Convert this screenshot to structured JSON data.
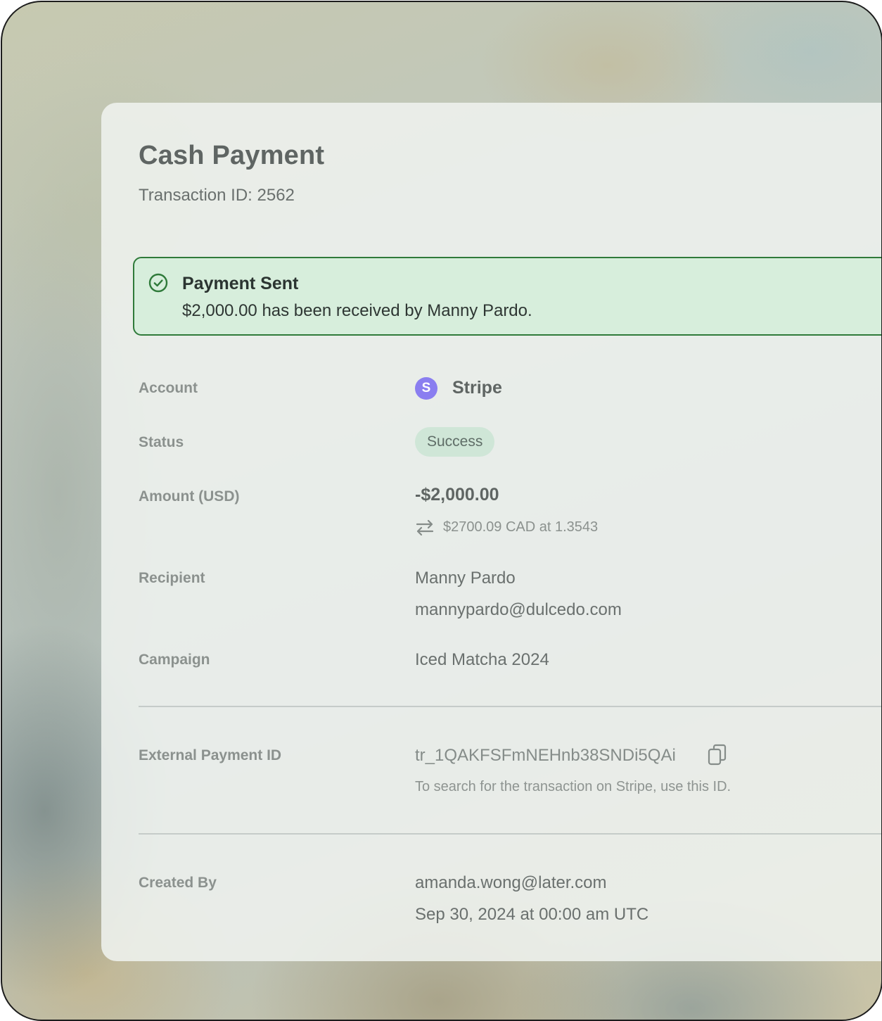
{
  "header": {
    "title": "Cash Payment",
    "transaction_id_label": "Transaction ID: 2562"
  },
  "alert": {
    "icon": "check-circle-icon",
    "title": "Payment Sent",
    "message": "$2,000.00 has been received by Manny Pardo.",
    "color": "#2f7a3a"
  },
  "details": {
    "account": {
      "label": "Account",
      "icon": "stripe-logo",
      "icon_letter": "S",
      "icon_color": "#8a7ef0",
      "value": "Stripe"
    },
    "status": {
      "label": "Status",
      "value": "Success"
    },
    "amount": {
      "label": "Amount (USD)",
      "value": "-$2,000.00",
      "conversion_icon": "swap-arrows-icon",
      "conversion": "$2700.09 CAD at 1.3543"
    },
    "recipient": {
      "label": "Recipient",
      "name": "Manny Pardo",
      "email": "mannypardo@dulcedo.com"
    },
    "campaign": {
      "label": "Campaign",
      "value": "Iced Matcha 2024"
    },
    "external_payment": {
      "label": "External Payment ID",
      "value": "tr_1QAKFSFmNEHnb38SNDi5QAi",
      "copy_icon": "copy-icon",
      "hint": "To search for the transaction on Stripe, use this ID."
    },
    "created_by": {
      "label": "Created By",
      "email": "amanda.wong@later.com",
      "timestamp": "Sep 30, 2024 at 00:00 am UTC"
    }
  }
}
